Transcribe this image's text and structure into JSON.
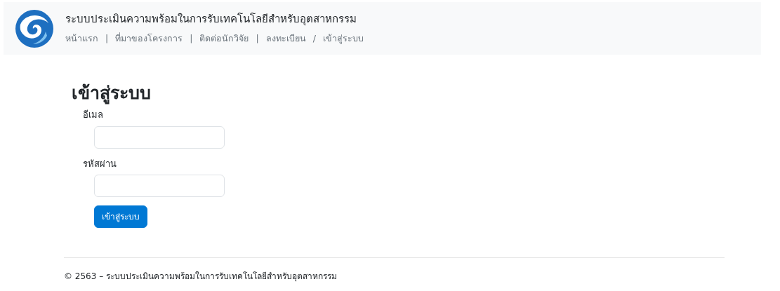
{
  "header": {
    "title": "ระบบประเมินความพร้อมในการรับเทคโนโลยีสำหรับอุตสาหกรรม",
    "nav": [
      {
        "kind": "link",
        "text": "หน้าแรก"
      },
      {
        "kind": "separator",
        "text": "|"
      },
      {
        "kind": "link",
        "text": "ที่มาของโครงการ"
      },
      {
        "kind": "separator",
        "text": "|"
      },
      {
        "kind": "link",
        "text": "ติดต่อนักวิจัย"
      },
      {
        "kind": "separator",
        "text": "|"
      },
      {
        "kind": "link",
        "text": "ลงทะเบียน"
      },
      {
        "kind": "separator",
        "text": "/"
      },
      {
        "kind": "link",
        "text": "เข้าสู่ระบบ"
      }
    ]
  },
  "login": {
    "heading": "เข้าสู่ระบบ",
    "fields": [
      {
        "label": "อีเมล"
      },
      {
        "label": "รหัสผ่าน"
      }
    ],
    "button": "เข้าสู่ระบบ"
  },
  "footer": "© 2563 – ระบบประเมินความพร้อมในการรับเทคโนโลยีสำหรับอุตสาหกรรม"
}
